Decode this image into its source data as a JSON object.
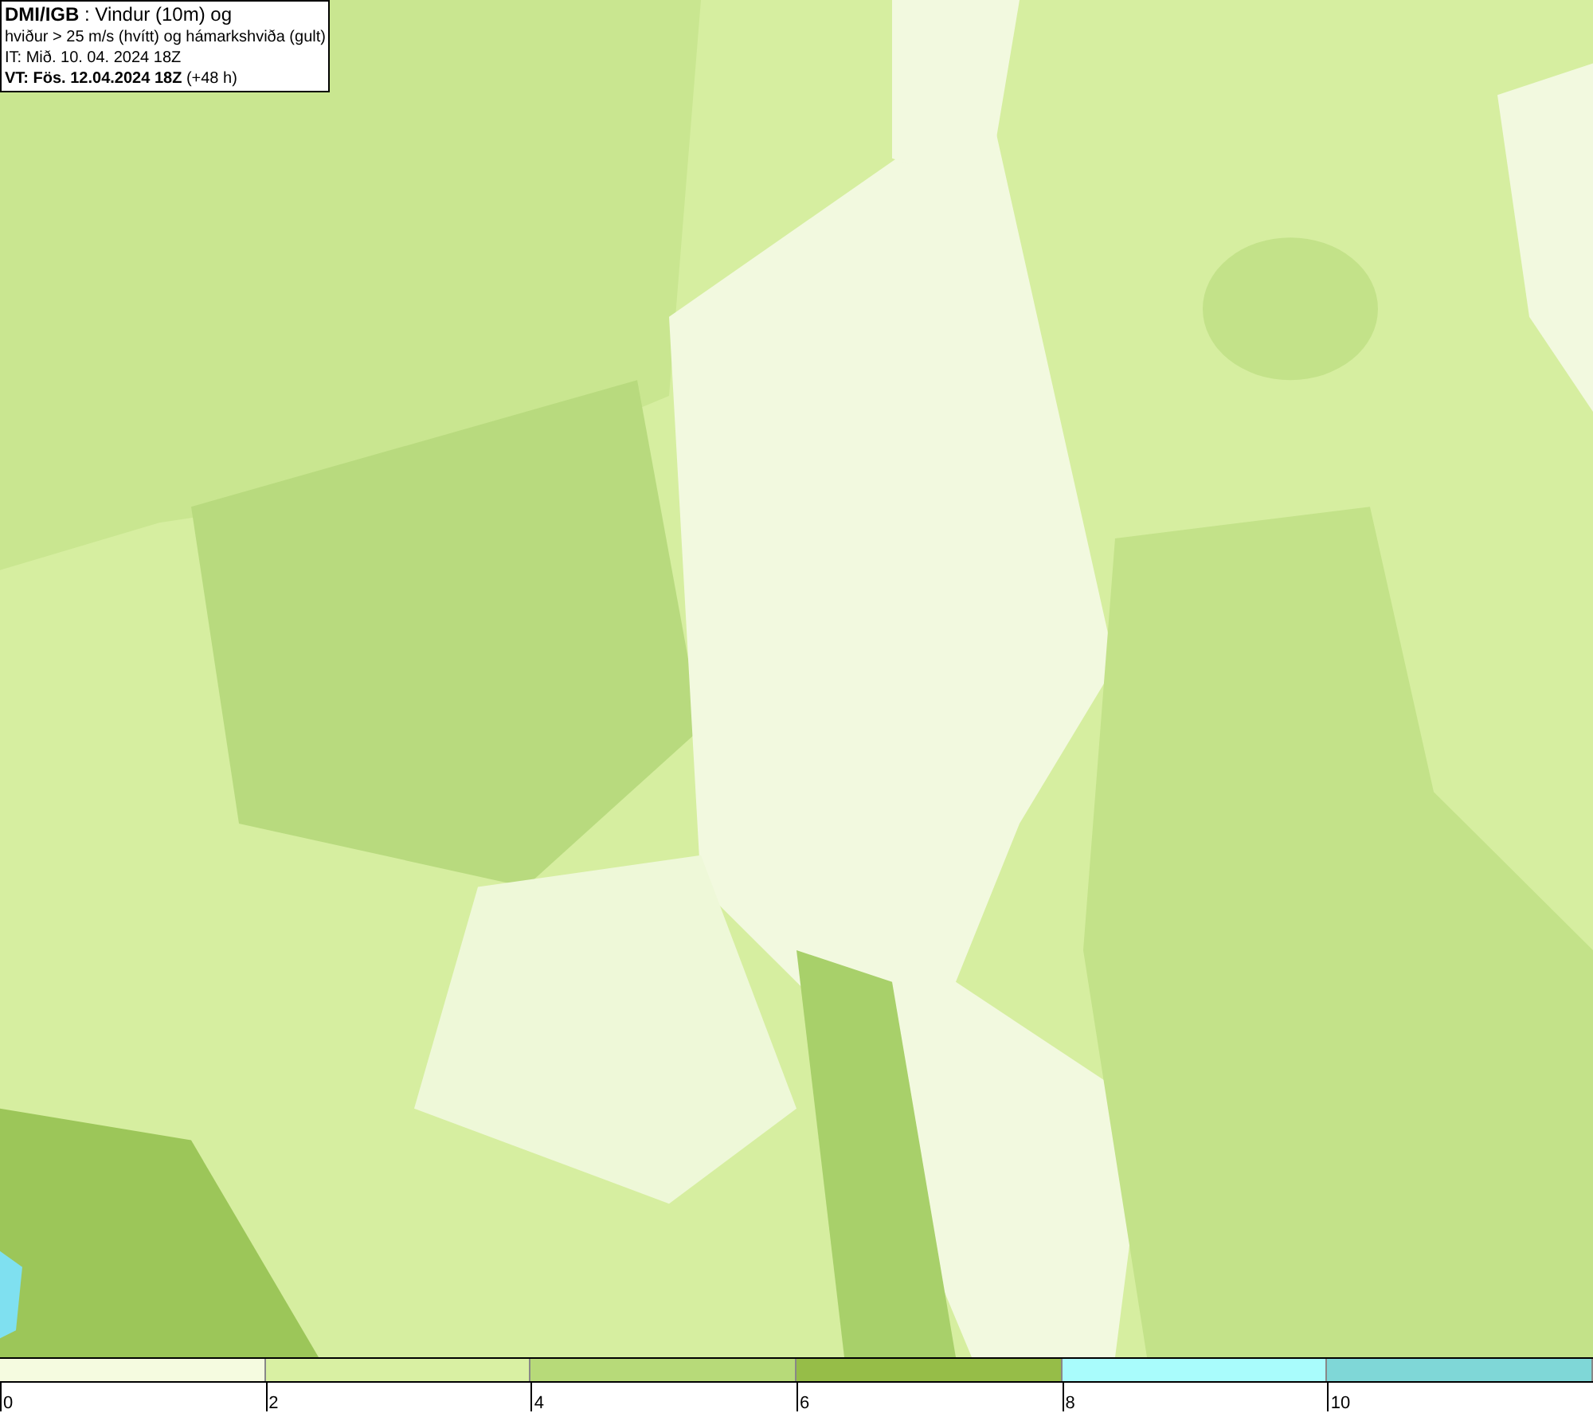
{
  "info_box": {
    "lines": [
      "**DMI/IGB** : Vindur (10m) og",
      "hviður > 25 m/s (hvítt) og hámarkshviða (gult)",
      "IT: Mið. 10. 04. 2024 18Z",
      "**VT: Fös. 12.04.2024 18Z** (+48 h)"
    ]
  },
  "legend": {
    "segments": [
      {
        "label": "0",
        "color": "#f5fbe0"
      },
      {
        "label": "2",
        "color": "#d9f0a3"
      },
      {
        "label": "4",
        "color": "#b7da79"
      },
      {
        "label": "6",
        "color": "#96bd48"
      },
      {
        "label": "8",
        "color": "#a9fcfc"
      },
      {
        "label": "10",
        "color": "#7fd7d7"
      }
    ]
  }
}
